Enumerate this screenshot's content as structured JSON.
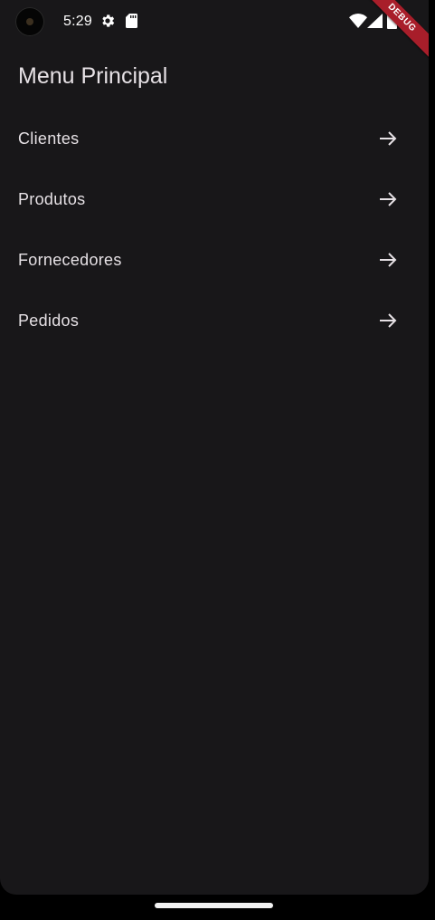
{
  "status_bar": {
    "time": "5:29",
    "icons": [
      "camera-cutout",
      "gear-icon",
      "sd-card-icon",
      "wifi-icon",
      "signal-icon",
      "battery-icon"
    ]
  },
  "debug_banner": {
    "label": "DEBUG",
    "color": "#a81e2a"
  },
  "app_bar": {
    "title": "Menu Principal"
  },
  "menu": {
    "items": [
      {
        "label": "Clientes",
        "trailing_icon": "arrow-forward-icon"
      },
      {
        "label": "Produtos",
        "trailing_icon": "arrow-forward-icon"
      },
      {
        "label": "Fornecedores",
        "trailing_icon": "arrow-forward-icon"
      },
      {
        "label": "Pedidos",
        "trailing_icon": "arrow-forward-icon"
      }
    ]
  },
  "colors": {
    "background": "#181719",
    "text": "#e6e1e5",
    "frame": "#000000"
  }
}
